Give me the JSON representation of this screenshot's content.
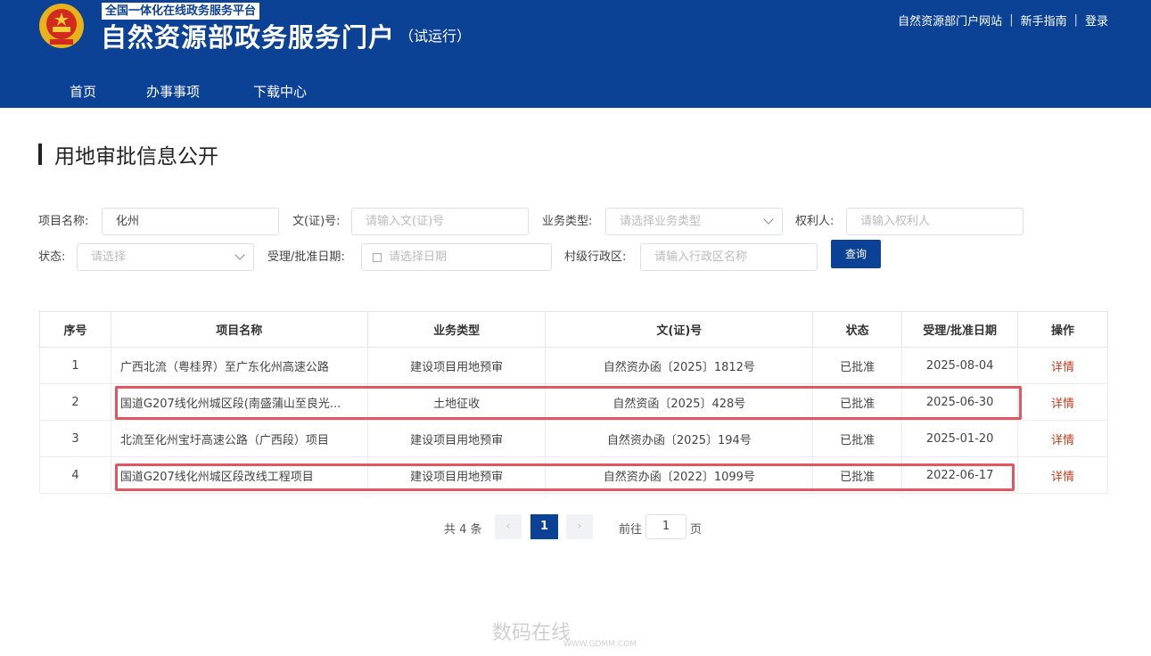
{
  "header": {
    "platform_tag": "全国一体化在线政务服务平台",
    "site_title": "自然资源部政务服务门户",
    "site_subtitle": "（试运行）",
    "links": [
      "自然资源部门户网站",
      "新手指南",
      "登录"
    ]
  },
  "nav": [
    "首页",
    "办事事项",
    "下载中心"
  ],
  "page_title": "用地审批信息公开",
  "filters": {
    "project_name": {
      "label": "项目名称:",
      "value": "化州"
    },
    "doc_no": {
      "label": "文(证)号:",
      "placeholder": "请输入文(证)号"
    },
    "biz_type": {
      "label": "业务类型:",
      "placeholder": "请选择业务类型"
    },
    "owner": {
      "label": "权利人:",
      "placeholder": "请输入权利人"
    },
    "status": {
      "label": "状态:",
      "placeholder": "请选择"
    },
    "date": {
      "label": "受理/批准日期:",
      "placeholder": "请选择日期"
    },
    "village": {
      "label": "村级行政区:",
      "placeholder": "请输入行政区名称"
    },
    "query_button": "查询"
  },
  "table": {
    "headers": [
      "序号",
      "项目名称",
      "业务类型",
      "文(证)号",
      "状态",
      "受理/批准日期",
      "操作"
    ],
    "rows": [
      [
        "1",
        "广西北流（粤桂界）至广东化州高速公路",
        "建设项目用地预审",
        "自然资办函〔2025〕1812号",
        "已批准",
        "2025-08-04",
        "详情"
      ],
      [
        "2",
        "国道G207线化州城区段(南盛蒲山至良光...",
        "土地征收",
        "自然资函〔2025〕428号",
        "已批准",
        "2025-06-30",
        "详情"
      ],
      [
        "3",
        "北流至化州宝圩高速公路（广西段）项目",
        "建设项目用地预审",
        "自然资办函〔2025〕194号",
        "已批准",
        "2025-01-20",
        "详情"
      ],
      [
        "4",
        "国道G207线化州城区段改线工程项目",
        "建设项目用地预审",
        "自然资办函〔2022〕1099号",
        "已批准",
        "2022-06-17",
        "详情"
      ]
    ]
  },
  "pager": {
    "total": "共 4 条",
    "prev": "‹",
    "current": "1",
    "next": "›",
    "goto_label": "前往",
    "goto_value": "1",
    "page_word": "页"
  },
  "watermark": {
    "text": "数码在线",
    "sub": "WWW.GDMM.COM"
  },
  "colors": {
    "brand": "#0c4295",
    "highlight": "#e05663",
    "detail_link": "#c63e1b"
  }
}
